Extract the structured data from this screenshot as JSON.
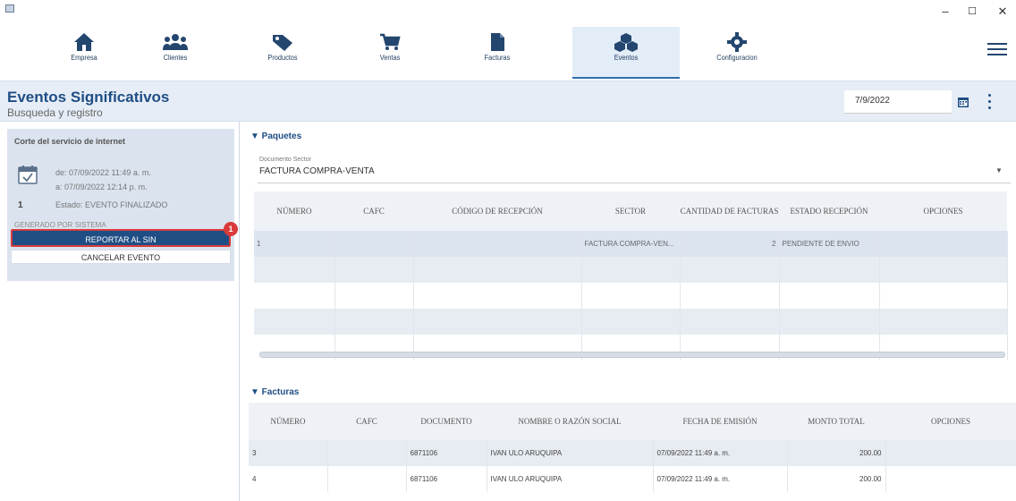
{
  "nav": {
    "items": [
      {
        "label": "Empresa",
        "icon": "home-icon"
      },
      {
        "label": "Clientes",
        "icon": "users-icon"
      },
      {
        "label": "Productos",
        "icon": "tag-icon"
      },
      {
        "label": "Ventas",
        "icon": "cart-icon"
      },
      {
        "label": "Facturas",
        "icon": "document-icon"
      },
      {
        "label": "Eventos",
        "icon": "cubes-icon"
      },
      {
        "label": "Configuracion",
        "icon": "gear-icon"
      }
    ],
    "active": "Eventos"
  },
  "window": {
    "minimize": "–",
    "maximize": "☐",
    "close": "✕"
  },
  "header": {
    "title": "Eventos Significativos",
    "subtitle": "Busqueda y registro",
    "date": "7/9/2022"
  },
  "sidebar": {
    "event_title": "Corte del servicio de internet",
    "from": "de:  07/09/2022 11:49 a. m.",
    "to": "a:  07/09/2022 12:14 p. m.",
    "number": "1",
    "status": "Estado:  EVENTO FINALIZADO",
    "generated": "GENERADO POR SISTEMA",
    "report_button": "REPORTAR AL SIN",
    "cancel_button": "CANCELAR EVENTO",
    "badge": "1"
  },
  "paquetes": {
    "section_title": "▼ Paquetes",
    "doc_label": "Documento Sector",
    "doc_value": "FACTURA COMPRA-VENTA",
    "columns": [
      "NÚMERO",
      "CAFC",
      "CÓDIGO DE RECEPCIÓN",
      "SECTOR",
      "CANTIDAD DE FACTURAS",
      "ESTADO RECEPCIÓN",
      "OPCIONES"
    ],
    "rows": [
      {
        "numero": "1",
        "cafc": "",
        "codigo": "",
        "sector": "FACTURA COMPRA-VEN...",
        "cantidad": "2",
        "estado": "PENDIENTE DE ENVIO",
        "opciones": ""
      }
    ]
  },
  "facturas": {
    "section_title": "▼ Facturas",
    "columns": [
      "NÚMERO",
      "CAFC",
      "DOCUMENTO",
      "NOMBRE O RAZÓN SOCIAL",
      "FECHA DE EMISIÓN",
      "MONTO TOTAL",
      "OPCIONES"
    ],
    "rows": [
      {
        "numero": "3",
        "cafc": "",
        "documento": "6871106",
        "nombre": "IVAN ULO ARUQUIPA",
        "fecha": "07/09/2022 11:49 a. m.",
        "monto": "200.00",
        "opciones": ""
      },
      {
        "numero": "4",
        "cafc": "",
        "documento": "6871106",
        "nombre": "IVAN ULO ARUQUIPA",
        "fecha": "07/09/2022 11:49 a. m.",
        "monto": "200.00",
        "opciones": ""
      }
    ]
  },
  "colors": {
    "primary": "#1f4e85",
    "highlight": "#d93b3b",
    "header_bg": "#e6edf6"
  }
}
